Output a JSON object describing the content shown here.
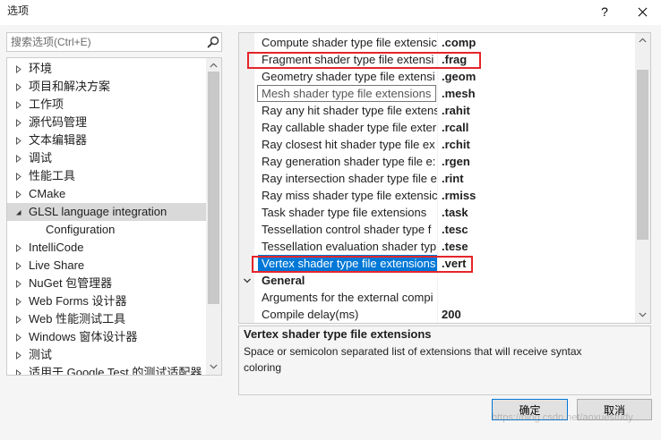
{
  "window": {
    "title": "选项",
    "help_label": "?",
    "close_icon": "close-icon"
  },
  "search": {
    "placeholder": "搜索选项(Ctrl+E)",
    "icon": "search-icon"
  },
  "tree": {
    "items": [
      {
        "label": "环境",
        "expander_icon": "collapsed-arrow-icon"
      },
      {
        "label": "项目和解决方案",
        "expander_icon": "collapsed-arrow-icon"
      },
      {
        "label": "工作项",
        "expander_icon": "collapsed-arrow-icon"
      },
      {
        "label": "源代码管理",
        "expander_icon": "collapsed-arrow-icon"
      },
      {
        "label": "文本编辑器",
        "expander_icon": "collapsed-arrow-icon"
      },
      {
        "label": "调试",
        "expander_icon": "collapsed-arrow-icon"
      },
      {
        "label": "性能工具",
        "expander_icon": "collapsed-arrow-icon"
      },
      {
        "label": "CMake",
        "expander_icon": "collapsed-arrow-icon"
      },
      {
        "label": "GLSL language integration",
        "expander_icon": "expanded-arrow-icon",
        "selected": true
      },
      {
        "label": "Configuration"
      },
      {
        "label": "IntelliCode",
        "expander_icon": "collapsed-arrow-icon"
      },
      {
        "label": "Live Share",
        "expander_icon": "collapsed-arrow-icon"
      },
      {
        "label": "NuGet 包管理器",
        "expander_icon": "collapsed-arrow-icon"
      },
      {
        "label": "Web Forms 设计器",
        "expander_icon": "collapsed-arrow-icon"
      },
      {
        "label": "Web 性能测试工具",
        "expander_icon": "collapsed-arrow-icon"
      },
      {
        "label": "Windows 窗体设计器",
        "expander_icon": "collapsed-arrow-icon"
      },
      {
        "label": "测试",
        "expander_icon": "collapsed-arrow-icon"
      },
      {
        "label": "适用于 Google Test 的测试适配器",
        "expander_icon": "collapsed-arrow-icon"
      }
    ]
  },
  "grid": {
    "rows": [
      {
        "name": "Compute shader type file extensic",
        "value": ".comp"
      },
      {
        "name": "Fragment shader type file extensi",
        "value": ".frag",
        "red_box": true
      },
      {
        "name": "Geometry shader type file extensi",
        "value": ".geom"
      },
      {
        "name": "",
        "value": ".mesh"
      },
      {
        "name": "Ray any hit shader type file extens",
        "value": ".rahit"
      },
      {
        "name": "Ray callable shader type file exter",
        "value": ".rcall"
      },
      {
        "name": "Ray closest hit shader type file ex",
        "value": ".rchit"
      },
      {
        "name": "Ray generation shader type file e:",
        "value": ".rgen"
      },
      {
        "name": "Ray intersection shader type file e",
        "value": ".rint"
      },
      {
        "name": "Ray miss shader type file extensic",
        "value": ".rmiss"
      },
      {
        "name": "Task shader type file extensions",
        "value": ".task"
      },
      {
        "name": "Tessellation control shader type f",
        "value": ".tesc"
      },
      {
        "name": "Tessellation evaluation shader typ",
        "value": ".tese"
      },
      {
        "name": "Vertex shader type file extensions",
        "value": ".vert",
        "selected": true,
        "red_box": true
      }
    ],
    "category": {
      "label": "General",
      "expander_icon": "chevron-down-icon"
    },
    "general_rows": [
      {
        "name": "Arguments for the external compi",
        "value": ""
      },
      {
        "name": "Compile delay(ms)",
        "value": "200"
      }
    ]
  },
  "tooltip": {
    "text": "Mesh shader type file extensions"
  },
  "description": {
    "title": "Vertex shader type file extensions",
    "text": "Space or semicolon separated list of extensions that will receive syntax coloring"
  },
  "buttons": {
    "ok": "确定",
    "cancel": "取消"
  },
  "watermark": "https://blog.csdn.net/aoxuestudy",
  "colors": {
    "selection": "#0078d7",
    "tree_selection": "#d9d9d9",
    "annotation_red": "#e5252a",
    "window_bg": "#f5f5f5",
    "border": "#cccccc",
    "scroll_thumb": "#c8c8c8"
  }
}
